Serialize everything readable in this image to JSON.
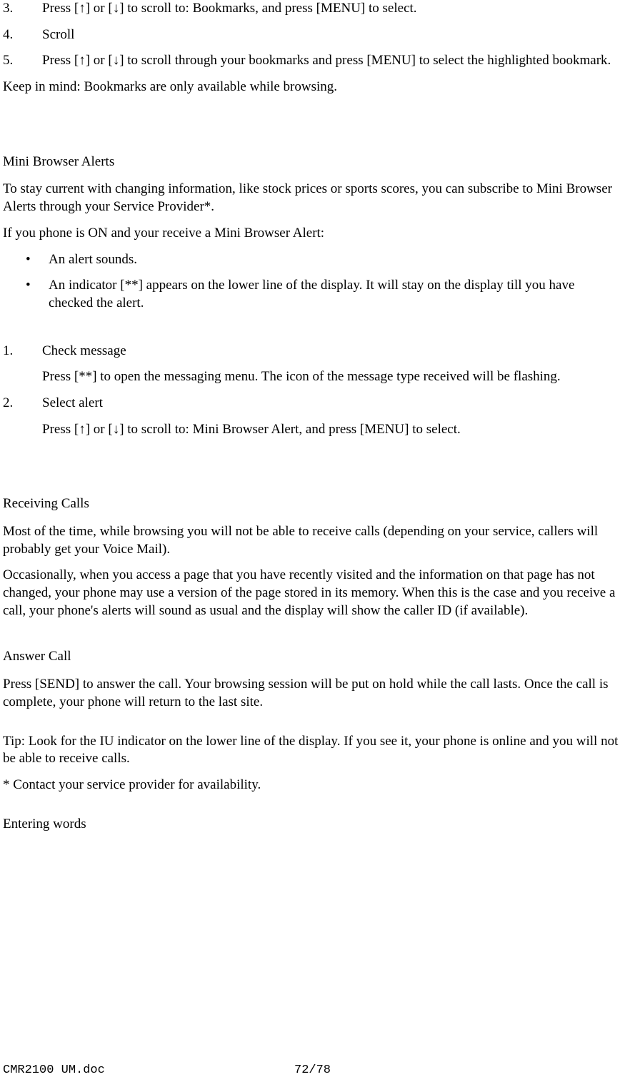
{
  "topList": {
    "item3": {
      "num": "3.",
      "text_a": "Press [",
      "arrow_up": "↑",
      "text_b": "] or [",
      "arrow_down": "↓",
      "text_c": "] to scroll to: Bookmarks, and press [MENU] to select."
    },
    "item4": {
      "num": "4.",
      "text": "Scroll"
    },
    "item5": {
      "num": "5.",
      "text_a": "Press [",
      "arrow_up": "↑",
      "text_b": "] or [",
      "arrow_down": "↓",
      "text_c": "] to scroll through your bookmarks and press [MENU] to select the highlighted bookmark."
    }
  },
  "keepInMind": "Keep in mind:  Bookmarks are only available while browsing.",
  "miniBrowser": {
    "heading": "Mini Browser Alerts",
    "p1": "To stay current with changing information, like stock prices or sports scores, you can subscribe to Mini Browser Alerts through your Service Provider*.",
    "p2": "If you phone is ON and your receive a Mini Browser Alert:",
    "b1": "An alert sounds.",
    "b2": "An indicator [**] appears on the lower line of the display. It will stay on the display till you have checked the alert."
  },
  "checkList": {
    "item1": {
      "num": "1.",
      "title": "Check message",
      "body": "Press [**] to open the messaging menu. The icon of the message type received will be flashing."
    },
    "item2": {
      "num": "2.",
      "title": "Select alert",
      "body_a": "Press [",
      "arrow_up": "↑",
      "body_b": "] or [",
      "arrow_down": "↓",
      "body_c": "] to scroll to: Mini Browser Alert, and press [MENU] to select."
    }
  },
  "receiving": {
    "heading": "Receiving Calls",
    "p1": "Most of the time, while browsing you will not be able to receive calls (depending on your service, callers will probably get your Voice Mail).",
    "p2": "Occasionally, when you access a page that you have recently visited and the information on that page has not changed, your phone may use a version of the page stored in its memory. When this is the case and you receive a call, your phone's alerts will sound as usual and the display will show the caller ID (if available)."
  },
  "answer": {
    "heading": "Answer Call",
    "p1": "Press [SEND] to answer the call. Your browsing session will be put on hold while the call lasts. Once the call is complete, your phone will return to the last site."
  },
  "tip": "Tip:  Look for the IU indicator on the lower line of the display. If you see it, your phone is online and you will not be able to receive calls.",
  "footnote": "* Contact your service provider for availability.",
  "entering": "Entering words",
  "footer": {
    "left": "CMR2100 UM.doc",
    "center": "72/78"
  }
}
